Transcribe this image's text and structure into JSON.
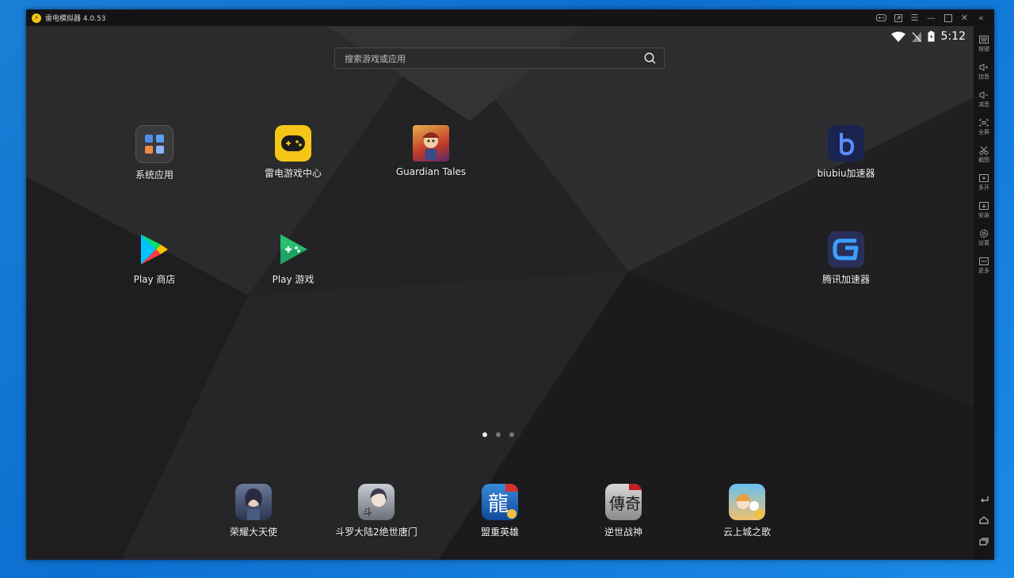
{
  "window": {
    "title": "雷电模拟器 4.0.53"
  },
  "status_bar": {
    "time": "5:12"
  },
  "search": {
    "placeholder": "搜索游戏或应用"
  },
  "desktop_apps": [
    {
      "label": "系统应用",
      "icon": "folder-icon"
    },
    {
      "label": "雷电游戏中心",
      "icon": "gamepad-icon"
    },
    {
      "label": "Guardian Tales",
      "icon": "guardian-tales-icon"
    },
    {
      "label": "biubiu加速器",
      "icon": "biubiu-icon"
    },
    {
      "label": "Play 商店",
      "icon": "play-store-icon"
    },
    {
      "label": "Play 游戏",
      "icon": "play-games-icon"
    },
    {
      "label": "腾讯加速器",
      "icon": "tencent-accelerator-icon"
    }
  ],
  "dock_apps": [
    {
      "label": "荣耀大天使",
      "icon": "archangel-icon"
    },
    {
      "label": "斗罗大陆2绝世唐门",
      "icon": "douluo-icon"
    },
    {
      "label": "盟重英雄",
      "icon": "mengzhong-icon"
    },
    {
      "label": "逆世战神",
      "icon": "nishi-icon"
    },
    {
      "label": "云上城之歌",
      "icon": "yunshang-icon"
    }
  ],
  "page_indicator": {
    "total": 3,
    "active": 1
  },
  "sidebar": {
    "items": [
      {
        "label": "按键",
        "icon": "keyboard-icon"
      },
      {
        "label": "加音",
        "icon": "volume-up-icon"
      },
      {
        "label": "减音",
        "icon": "volume-down-icon"
      },
      {
        "label": "全屏",
        "icon": "fullscreen-icon"
      },
      {
        "label": "截图",
        "icon": "scissors-icon"
      },
      {
        "label": "多开",
        "icon": "multi-instance-icon"
      },
      {
        "label": "安装",
        "icon": "install-icon"
      },
      {
        "label": "设置",
        "icon": "gear-icon"
      },
      {
        "label": "更多",
        "icon": "more-icon"
      }
    ]
  },
  "colors": {
    "accent": "#f5c518",
    "desktop_bg": "#232325",
    "outer_bg": "#1a7fd6"
  }
}
